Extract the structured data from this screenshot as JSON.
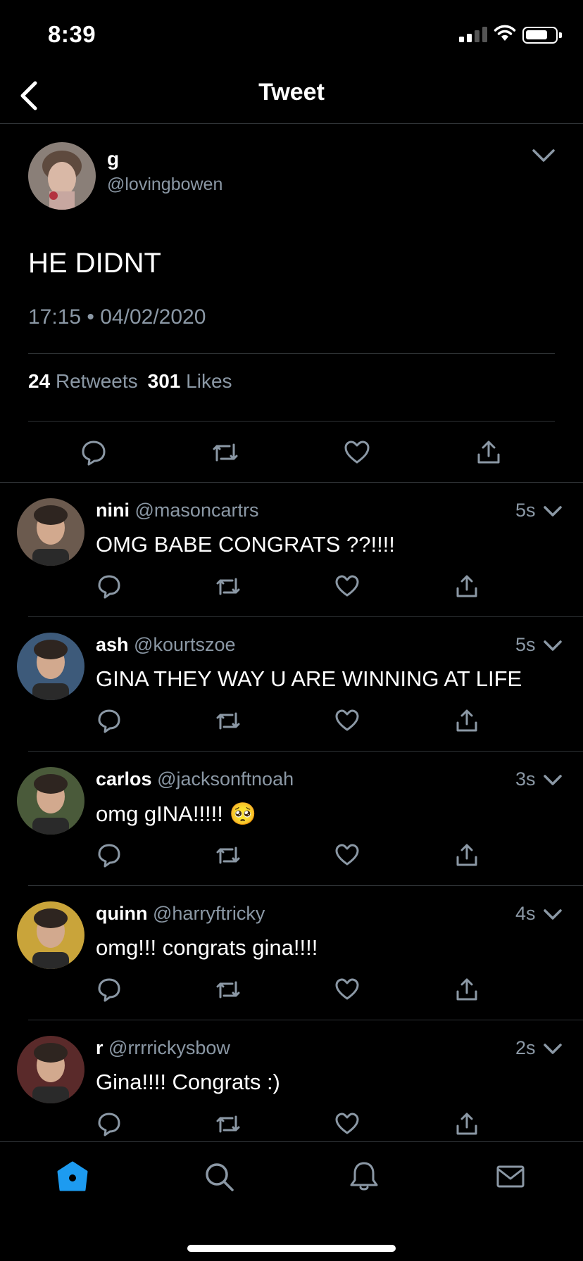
{
  "status_bar": {
    "time": "8:39"
  },
  "nav": {
    "title": "Tweet"
  },
  "tweet": {
    "author_name": "g",
    "author_handle": "@lovingbowen",
    "text": "HE DIDNT",
    "timestamp": "17:15 • 04/02/2020",
    "retweets_count": "24",
    "retweets_label": "Retweets",
    "likes_count": "301",
    "likes_label": "Likes"
  },
  "replies": [
    {
      "name": "nini",
      "handle": "@masoncartrs",
      "time": "5s",
      "text": "OMG BABE CONGRATS ??!!!!",
      "avatar_color": "#6b5a4e"
    },
    {
      "name": "ash",
      "handle": "@kourtszoe",
      "time": "5s",
      "text": "GINA THEY WAY U ARE WINNING AT LIFE",
      "avatar_color": "#3d5a7a"
    },
    {
      "name": "carlos",
      "handle": "@jacksonftnoah",
      "time": "3s",
      "text": "omg gINA!!!!! 🥺",
      "avatar_color": "#4a5a3a"
    },
    {
      "name": "quinn",
      "handle": "@harryftricky",
      "time": "4s",
      "text": "omg!!! congrats gina!!!!",
      "avatar_color": "#c9a43a"
    },
    {
      "name": "r",
      "handle": "@rrrrickysbow",
      "time": "2s",
      "text": "Gina!!!! Congrats :)",
      "avatar_color": "#5a2a2a"
    }
  ],
  "colors": {
    "accent": "#1d9bf0",
    "muted": "#8b98a5",
    "divider": "#2f3336"
  },
  "tab_bar": {
    "icons": [
      "home-icon",
      "search-icon",
      "bell-icon",
      "mail-icon"
    ],
    "active": "home-icon"
  }
}
